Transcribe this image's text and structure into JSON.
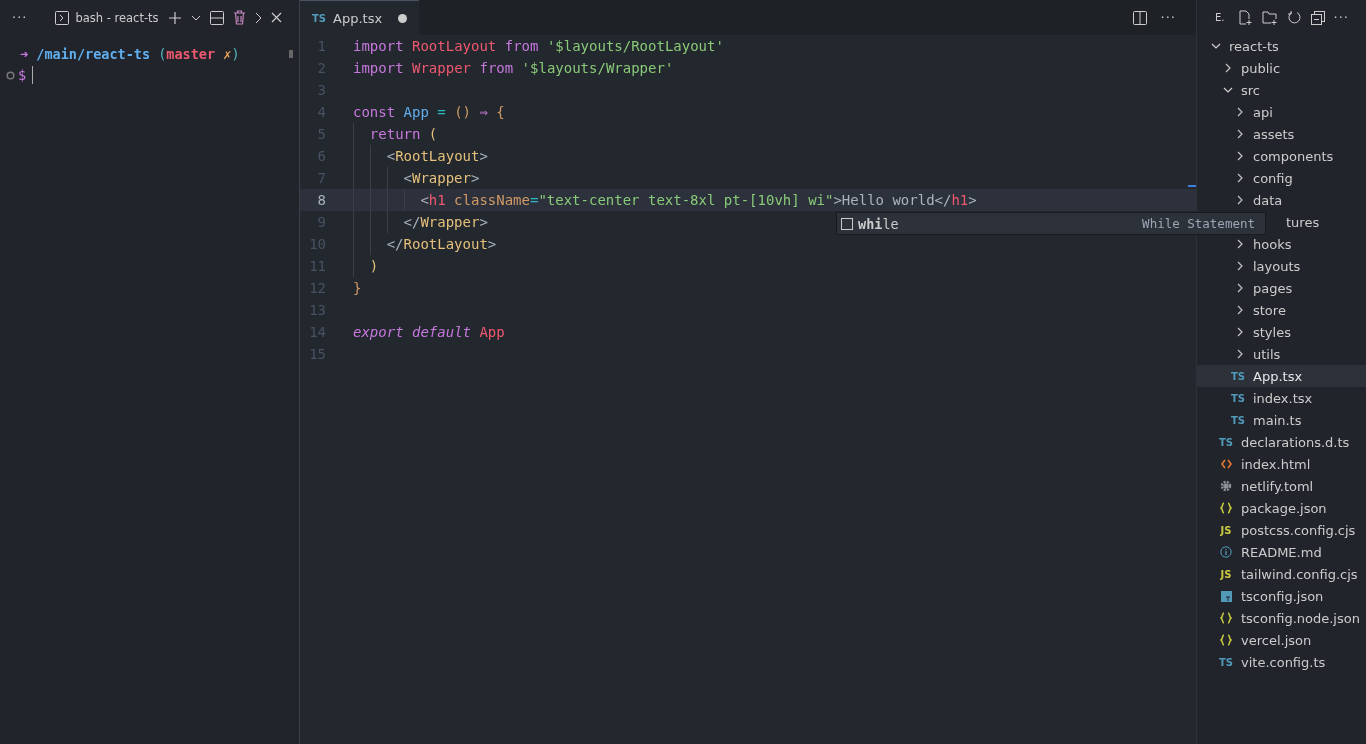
{
  "terminal": {
    "more": "···",
    "tab_title": "bash - react-ts",
    "prompt": [
      {
        "kind": "arrow",
        "t": "➜"
      },
      {
        "kind": "path",
        "t": " /main/react-ts "
      },
      {
        "kind": "paren",
        "t": "("
      },
      {
        "kind": "branch",
        "t": "master "
      },
      {
        "kind": "dirty",
        "t": "✗"
      },
      {
        "kind": "paren",
        "t": ")"
      }
    ],
    "input_prompt": "$"
  },
  "editor": {
    "tab": {
      "label": "App.tsx",
      "badge": "TS",
      "modified": true
    },
    "more": "···",
    "lines": [
      {
        "number": "1",
        "current": false,
        "tokens": [
          {
            "kind": "kw",
            "t": "import "
          },
          {
            "kind": "var",
            "t": "RootLayout "
          },
          {
            "kind": "kw",
            "t": "from "
          },
          {
            "kind": "str",
            "t": "'$layouts/RootLayout'"
          }
        ]
      },
      {
        "number": "2",
        "current": false,
        "tokens": [
          {
            "kind": "kw",
            "t": "import "
          },
          {
            "kind": "var",
            "t": "Wrapper "
          },
          {
            "kind": "kw",
            "t": "from "
          },
          {
            "kind": "str",
            "t": "'$layouts/Wrapper'"
          }
        ]
      },
      {
        "number": "3",
        "current": false
      },
      {
        "number": "4",
        "current": false,
        "tokens": [
          {
            "kind": "kw",
            "t": "const "
          },
          {
            "kind": "fn",
            "t": "App "
          },
          {
            "kind": "op",
            "t": "= "
          },
          {
            "kind": "punc",
            "t": "() "
          },
          {
            "kind": "kw",
            "t": "⇒ "
          },
          {
            "kind": "punc",
            "t": "{"
          }
        ]
      },
      {
        "number": "5",
        "current": false,
        "tokens": [
          {
            "kind": "kw",
            "t": "  return "
          },
          {
            "kind": "brace",
            "t": "("
          }
        ]
      },
      {
        "number": "6",
        "current": false,
        "tokens": [
          {
            "kind": "plain",
            "t": "    <"
          },
          {
            "kind": "comp",
            "t": "RootLayout"
          },
          {
            "kind": "plain",
            "t": ">"
          }
        ]
      },
      {
        "number": "7",
        "current": false,
        "tokens": [
          {
            "kind": "plain",
            "t": "      <"
          },
          {
            "kind": "comp",
            "t": "Wrapper"
          },
          {
            "kind": "plain",
            "t": ">"
          }
        ]
      },
      {
        "number": "8",
        "current": true,
        "tokens": [
          {
            "kind": "plain",
            "t": "        <"
          },
          {
            "kind": "var",
            "t": "h1 "
          },
          {
            "kind": "attr",
            "t": "className"
          },
          {
            "kind": "op",
            "t": "="
          },
          {
            "kind": "str",
            "t": "\"text-center text-8xl pt-[10vh] wi\""
          },
          {
            "kind": "plain",
            "t": ">Hello world</"
          },
          {
            "kind": "var",
            "t": "h1"
          },
          {
            "kind": "plain",
            "t": ">"
          }
        ]
      },
      {
        "number": "9",
        "current": false,
        "tokens": [
          {
            "kind": "plain",
            "t": "      </"
          },
          {
            "kind": "comp",
            "t": "Wrapper"
          },
          {
            "kind": "plain",
            "t": ">"
          }
        ]
      },
      {
        "number": "10",
        "current": false,
        "tokens": [
          {
            "kind": "plain",
            "t": "    </"
          },
          {
            "kind": "comp",
            "t": "RootLayout"
          },
          {
            "kind": "plain",
            "t": ">"
          }
        ]
      },
      {
        "number": "11",
        "current": false,
        "tokens": [
          {
            "kind": "brace",
            "t": "  )"
          }
        ]
      },
      {
        "number": "12",
        "current": false,
        "tokens": [
          {
            "kind": "punc",
            "t": "}"
          }
        ]
      },
      {
        "number": "13",
        "current": false
      },
      {
        "number": "14",
        "current": false,
        "tokens": [
          {
            "kind": "italic",
            "t": "export default "
          },
          {
            "kind": "var",
            "t": "App"
          }
        ]
      },
      {
        "number": "15",
        "current": false
      }
    ],
    "suggestion": {
      "label": "**whi**le",
      "detail": "While Statement"
    }
  },
  "explorer": {
    "title": "E.",
    "more": "···",
    "tree": [
      {
        "label": "react-ts",
        "kind": "folder",
        "expanded": true,
        "selected": false,
        "children": [
          {
            "label": "public",
            "kind": "folder",
            "expanded": false,
            "selected": false
          },
          {
            "label": "src",
            "kind": "folder",
            "expanded": true,
            "selected": false,
            "children": [
              {
                "label": "api",
                "kind": "folder",
                "expanded": false,
                "selected": false
              },
              {
                "label": "assets",
                "kind": "folder",
                "expanded": false,
                "selected": false
              },
              {
                "label": "components",
                "kind": "folder",
                "expanded": false,
                "selected": false
              },
              {
                "label": "config",
                "kind": "folder",
                "expanded": false,
                "selected": false
              },
              {
                "label": "data",
                "kind": "folder",
                "expanded": false,
                "selected": false
              },
              {
                "label": "tures",
                "kind": "covered",
                "selected": false
              },
              {
                "label": "hooks",
                "kind": "folder",
                "expanded": false,
                "selected": false
              },
              {
                "label": "layouts",
                "kind": "folder",
                "expanded": false,
                "selected": false
              },
              {
                "label": "pages",
                "kind": "folder",
                "expanded": false,
                "selected": false
              },
              {
                "label": "store",
                "kind": "folder",
                "expanded": false,
                "selected": false
              },
              {
                "label": "styles",
                "kind": "folder",
                "expanded": false,
                "selected": false
              },
              {
                "label": "utils",
                "kind": "folder",
                "expanded": false,
                "selected": false
              },
              {
                "label": "App.tsx",
                "kind": "ts",
                "badge": "TS",
                "selected": true
              },
              {
                "label": "index.tsx",
                "kind": "ts",
                "badge": "TS",
                "selected": false
              },
              {
                "label": "main.ts",
                "kind": "ts",
                "badge": "TS",
                "selected": false
              }
            ]
          },
          {
            "label": "declarations.d.ts",
            "kind": "ts",
            "badge": "TS",
            "selected": false
          },
          {
            "label": "index.html",
            "kind": "html",
            "selected": false
          },
          {
            "label": "netlify.toml",
            "kind": "gear",
            "selected": false
          },
          {
            "label": "package.json",
            "kind": "json",
            "selected": false
          },
          {
            "label": "postcss.config.cjs",
            "kind": "js",
            "badge": "JS",
            "selected": false
          },
          {
            "label": "README.md",
            "kind": "info",
            "selected": false
          },
          {
            "label": "tailwind.config.cjs",
            "kind": "js",
            "badge": "JS",
            "selected": false
          },
          {
            "label": "tsconfig.json",
            "kind": "tsconfig",
            "selected": false
          },
          {
            "label": "tsconfig.node.json",
            "kind": "json",
            "selected": false
          },
          {
            "label": "vercel.json",
            "kind": "json",
            "selected": false
          },
          {
            "label": "vite.config.ts",
            "kind": "ts",
            "badge": "TS",
            "selected": false
          }
        ]
      }
    ]
  }
}
